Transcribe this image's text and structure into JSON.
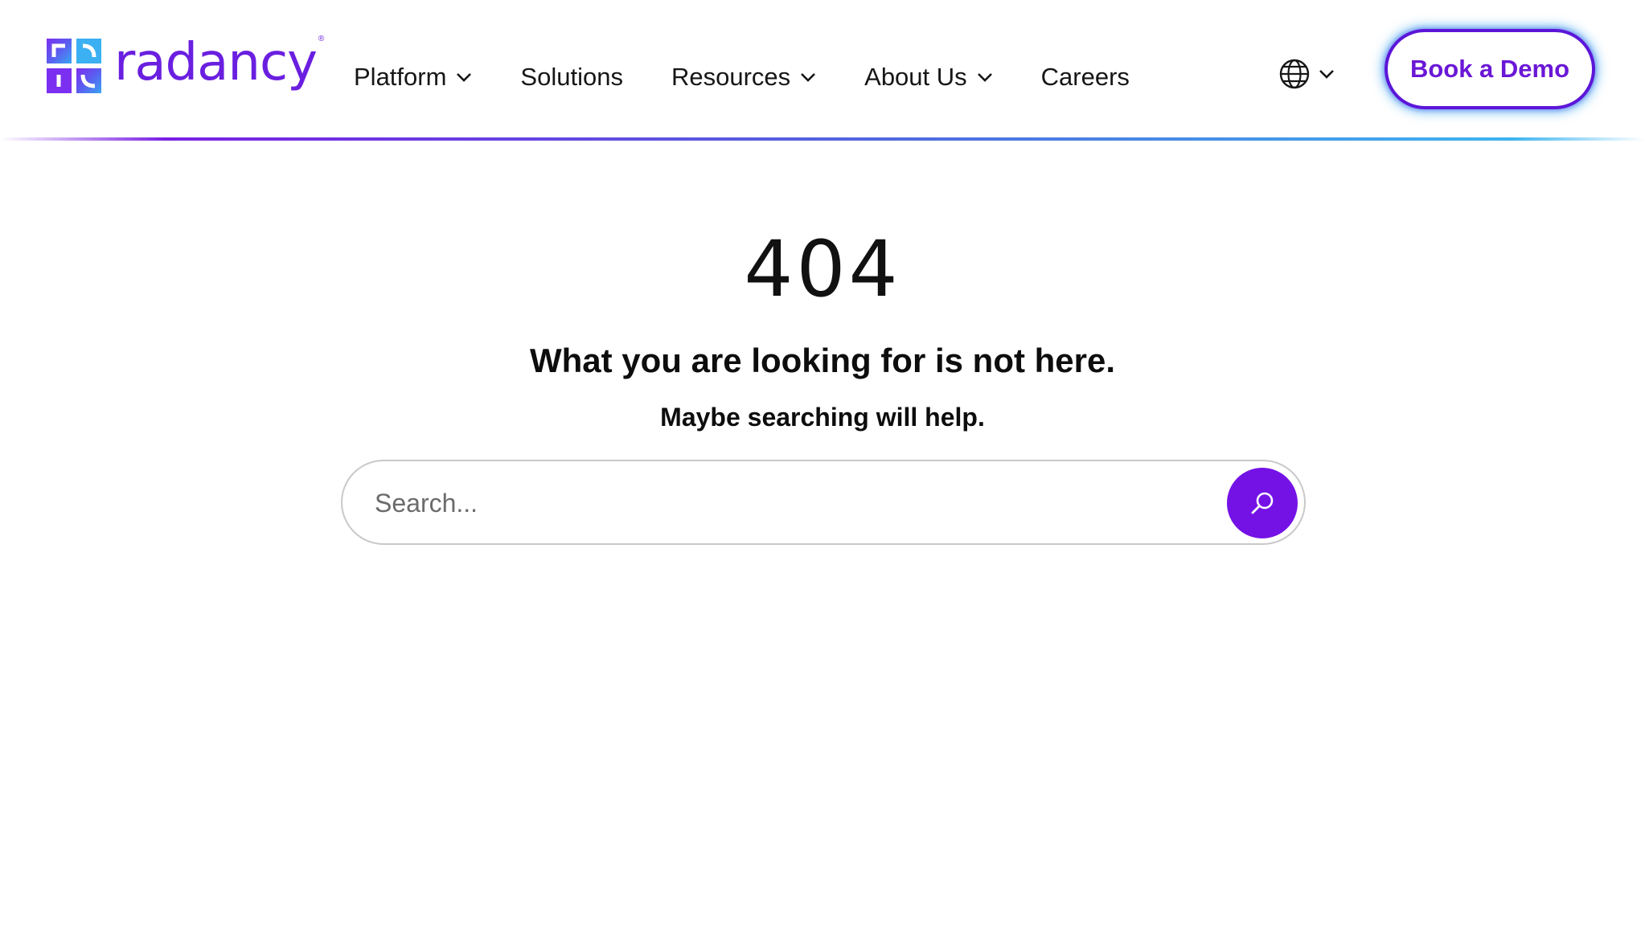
{
  "brand": {
    "name": "radancy",
    "registered": "®",
    "colors": {
      "primary": "#6a1fe0",
      "accent_blue": "#3db4ef",
      "button": "#7412e6"
    }
  },
  "nav": {
    "items": [
      {
        "label": "Platform",
        "has_dropdown": true
      },
      {
        "label": "Solutions",
        "has_dropdown": false
      },
      {
        "label": "Resources",
        "has_dropdown": true
      },
      {
        "label": "About Us",
        "has_dropdown": true
      },
      {
        "label": "Careers",
        "has_dropdown": false
      }
    ],
    "language_icon": "globe-icon",
    "cta_label": "Book a Demo"
  },
  "error": {
    "code": "404",
    "headline": "What you are looking for is not here.",
    "subline": "Maybe searching will help."
  },
  "search": {
    "placeholder": "Search...",
    "value": "",
    "button_icon": "search-icon"
  }
}
